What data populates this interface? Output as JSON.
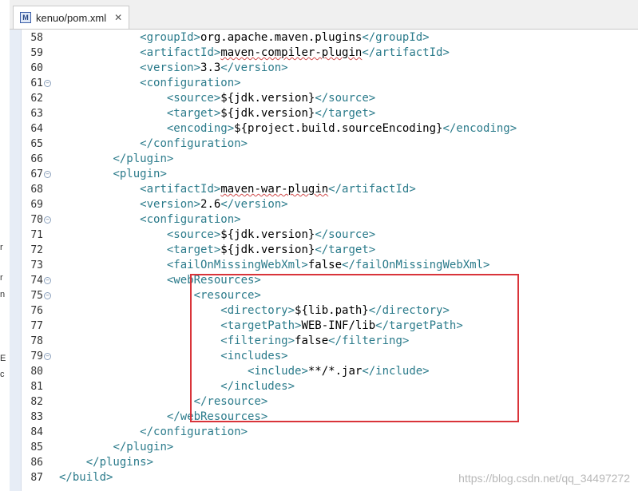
{
  "tab": {
    "title": "kenuo/pom.xml",
    "icon": "maven-icon",
    "close_glyph": "✕"
  },
  "left_strip_chars": [
    "r",
    "r",
    "n",
    "E",
    "c"
  ],
  "lines": [
    {
      "num": "58",
      "indent": "            ",
      "tag": "groupId",
      "text": "org.apache.maven.plugins",
      "close": "groupId"
    },
    {
      "num": "59",
      "indent": "            ",
      "tag": "artifactId",
      "text": "maven-compiler-plugin",
      "close": "artifactId",
      "squiggle": true
    },
    {
      "num": "60",
      "indent": "            ",
      "tag": "version",
      "text": "3.3",
      "close": "version"
    },
    {
      "num": "61",
      "fold": true,
      "indent": "            ",
      "tag": "configuration"
    },
    {
      "num": "62",
      "indent": "                ",
      "tag": "source",
      "text": "${jdk.version}",
      "close": "source"
    },
    {
      "num": "63",
      "indent": "                ",
      "tag": "target",
      "text": "${jdk.version}",
      "close": "target"
    },
    {
      "num": "64",
      "indent": "                ",
      "tag": "encoding",
      "text": "${project.build.sourceEncoding}",
      "close": "encoding"
    },
    {
      "num": "65",
      "indent": "            ",
      "close": "configuration"
    },
    {
      "num": "66",
      "indent": "        ",
      "close": "plugin"
    },
    {
      "num": "67",
      "fold": true,
      "indent": "        ",
      "tag": "plugin"
    },
    {
      "num": "68",
      "indent": "            ",
      "tag": "artifactId",
      "text": "maven-war-plugin",
      "close": "artifactId",
      "squiggle": true
    },
    {
      "num": "69",
      "indent": "            ",
      "tag": "version",
      "text": "2.6",
      "close": "version"
    },
    {
      "num": "70",
      "fold": true,
      "indent": "            ",
      "tag": "configuration"
    },
    {
      "num": "71",
      "indent": "                ",
      "tag": "source",
      "text": "${jdk.version}",
      "close": "source"
    },
    {
      "num": "72",
      "indent": "                ",
      "tag": "target",
      "text": "${jdk.version}",
      "close": "target"
    },
    {
      "num": "73",
      "indent": "                ",
      "tag": "failOnMissingWebXml",
      "text": "false",
      "close": "failOnMissingWebXml"
    },
    {
      "num": "74",
      "fold": true,
      "indent": "                ",
      "tag": "webResources"
    },
    {
      "num": "75",
      "fold": true,
      "indent": "                    ",
      "tag": "resource"
    },
    {
      "num": "76",
      "indent": "                        ",
      "tag": "directory",
      "text": "${lib.path}",
      "close": "directory"
    },
    {
      "num": "77",
      "indent": "                        ",
      "tag": "targetPath",
      "text": "WEB-INF/lib",
      "close": "targetPath"
    },
    {
      "num": "78",
      "indent": "                        ",
      "tag": "filtering",
      "text": "false",
      "close": "filtering"
    },
    {
      "num": "79",
      "fold": true,
      "indent": "                        ",
      "tag": "includes"
    },
    {
      "num": "80",
      "indent": "                            ",
      "tag": "include",
      "text": "**/*.jar",
      "close": "include"
    },
    {
      "num": "81",
      "indent": "                        ",
      "close": "includes"
    },
    {
      "num": "82",
      "indent": "                    ",
      "close": "resource"
    },
    {
      "num": "83",
      "indent": "                ",
      "close": "webResources"
    },
    {
      "num": "84",
      "indent": "            ",
      "close": "configuration"
    },
    {
      "num": "85",
      "indent": "        ",
      "close": "plugin"
    },
    {
      "num": "86",
      "indent": "    ",
      "close": "plugins"
    },
    {
      "num": "87",
      "indent": "",
      "close": "build"
    }
  ],
  "watermark": "https://blog.csdn.net/qq_34497272"
}
